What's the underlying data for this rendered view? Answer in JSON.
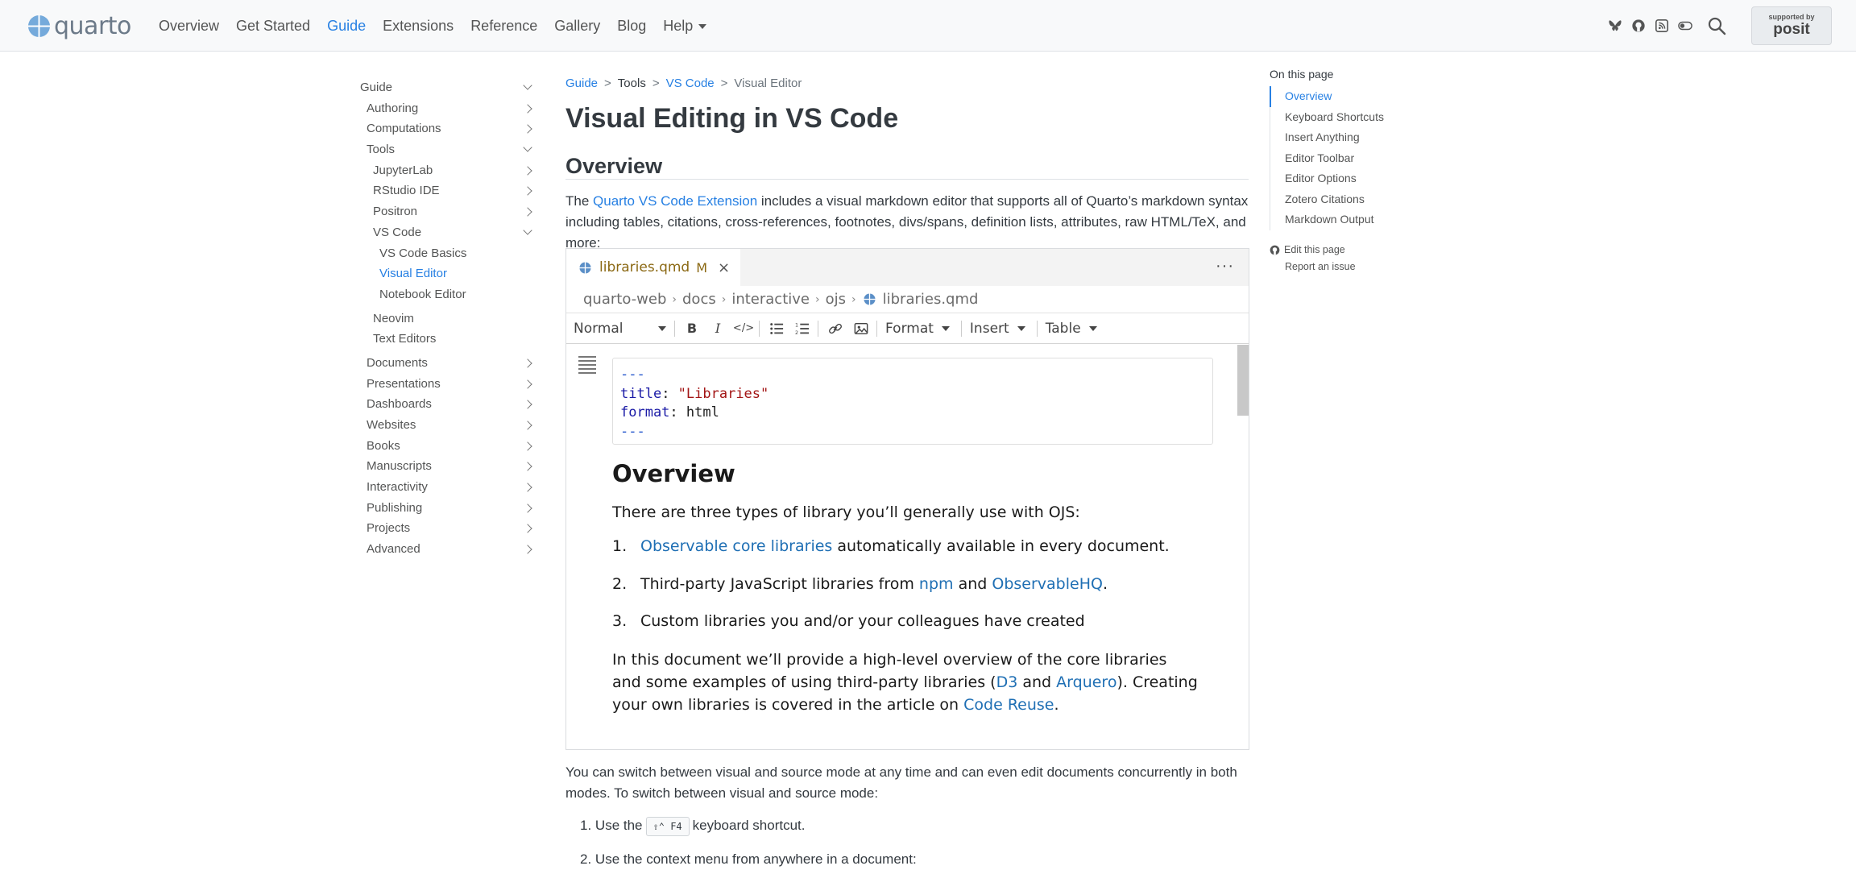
{
  "navbar": {
    "brand": "quarto",
    "links": [
      {
        "label": "Overview",
        "active": false
      },
      {
        "label": "Get Started",
        "active": false
      },
      {
        "label": "Guide",
        "active": true
      },
      {
        "label": "Extensions",
        "active": false
      },
      {
        "label": "Reference",
        "active": false
      },
      {
        "label": "Gallery",
        "active": false
      },
      {
        "label": "Blog",
        "active": false
      }
    ],
    "help_label": "Help",
    "icons": [
      "bluesky-icon",
      "github-icon",
      "rss-icon",
      "toggle-icon",
      "search-icon"
    ],
    "posit": {
      "small": "supported by",
      "name": "posit"
    }
  },
  "sidebar": {
    "items": [
      {
        "label": "Guide",
        "level": 0,
        "chevron": "down"
      },
      {
        "label": "Authoring",
        "level": 1,
        "chevron": "right"
      },
      {
        "label": "Computations",
        "level": 1,
        "chevron": "right"
      },
      {
        "label": "Tools",
        "level": 1,
        "chevron": "down"
      },
      {
        "label": "JupyterLab",
        "level": 2,
        "chevron": "right"
      },
      {
        "label": "RStudio IDE",
        "level": 2,
        "chevron": "right"
      },
      {
        "label": "Positron",
        "level": 2,
        "chevron": "right"
      },
      {
        "label": "VS Code",
        "level": 2,
        "chevron": "down"
      },
      {
        "label": "VS Code Basics",
        "level": 3,
        "chevron": ""
      },
      {
        "label": "Visual Editor",
        "level": 3,
        "chevron": "",
        "active": true
      },
      {
        "label": "Notebook Editor",
        "level": 3,
        "chevron": ""
      },
      {
        "label": "Neovim",
        "level": 2,
        "chevron": "",
        "gap": true
      },
      {
        "label": "Text Editors",
        "level": 2,
        "chevron": ""
      },
      {
        "label": "Documents",
        "level": 1,
        "chevron": "right",
        "gap": true
      },
      {
        "label": "Presentations",
        "level": 1,
        "chevron": "right"
      },
      {
        "label": "Dashboards",
        "level": 1,
        "chevron": "right"
      },
      {
        "label": "Websites",
        "level": 1,
        "chevron": "right"
      },
      {
        "label": "Books",
        "level": 1,
        "chevron": "right"
      },
      {
        "label": "Manuscripts",
        "level": 1,
        "chevron": "right"
      },
      {
        "label": "Interactivity",
        "level": 1,
        "chevron": "right"
      },
      {
        "label": "Publishing",
        "level": 1,
        "chevron": "right"
      },
      {
        "label": "Projects",
        "level": 1,
        "chevron": "right"
      },
      {
        "label": "Advanced",
        "level": 1,
        "chevron": "right"
      }
    ]
  },
  "breadcrumb": {
    "guide": "Guide",
    "tools": "Tools",
    "vscode": "VS Code",
    "current": "Visual Editor",
    "sep": ">"
  },
  "page": {
    "title": "Visual Editing in VS Code",
    "section_title": "Overview",
    "intro_pre": "The ",
    "intro_link": "Quarto VS Code Extension",
    "intro_post": " includes a visual markdown editor that supports all of Quarto’s markdown syntax including tables, citations, cross-references, footnotes, divs/spans, definition lists, attributes, raw HTML/TeX, and more:",
    "switch_text": "You can switch between visual and source mode at any time and can even edit documents concurrently in both modes. To switch between visual and source mode:",
    "steps": {
      "step1_num": "1.",
      "step1_pre": "Use the",
      "step1_kbd": "⇧⌃ F4",
      "step1_post": "keyboard shortcut.",
      "step2_num": "2.",
      "step2": "Use the context menu from anywhere in a document:"
    }
  },
  "screenshot": {
    "tab_name": "libraries.qmd",
    "tab_badge": "M",
    "tab_close": "×",
    "more": "···",
    "path": [
      "quarto-web",
      "docs",
      "interactive",
      "ojs",
      "libraries.qmd"
    ],
    "path_sep": "›",
    "toolbar": {
      "style": "Normal",
      "format": "Format",
      "insert": "Insert",
      "table": "Table"
    },
    "yaml": {
      "dash": "---",
      "title_key": "title",
      "title_val": "\"Libraries\"",
      "format_key": "format",
      "format_val": "html"
    },
    "doc": {
      "heading": "Overview",
      "p1": "There are three types of library you’ll generally use with OJS:",
      "li1_num": "1.",
      "li1_link": "Observable core libraries",
      "li1_post": " automatically available in every document.",
      "li2_num": "2.",
      "li2_pre": "Third-party JavaScript libraries from ",
      "li2_link1": "npm",
      "li2_mid": " and ",
      "li2_link2": "ObservableHQ",
      "li2_post": ".",
      "li3_num": "3.",
      "li3": "Custom libraries you and/or your colleagues have created",
      "p2_pre": "In this document we’ll provide a high-level overview of the core libraries and some examples of using third-party libraries (",
      "p2_link1": "D3",
      "p2_mid": " and ",
      "p2_link2": "Arquero",
      "p2_mid2": "). Creating your own libraries is covered in the article on ",
      "p2_link3": "Code Reuse",
      "p2_post": "."
    }
  },
  "toc": {
    "title": "On this page",
    "items": [
      {
        "label": "Overview",
        "active": true
      },
      {
        "label": "Keyboard Shortcuts"
      },
      {
        "label": "Insert Anything"
      },
      {
        "label": "Editor Toolbar"
      },
      {
        "label": "Editor Options"
      },
      {
        "label": "Zotero Citations"
      },
      {
        "label": "Markdown Output"
      }
    ],
    "edit": "Edit this page",
    "report": "Report an issue"
  },
  "colors": {
    "accent": "#2780e3",
    "text": "#343a40",
    "navbar_bg": "#f8f9fa"
  }
}
